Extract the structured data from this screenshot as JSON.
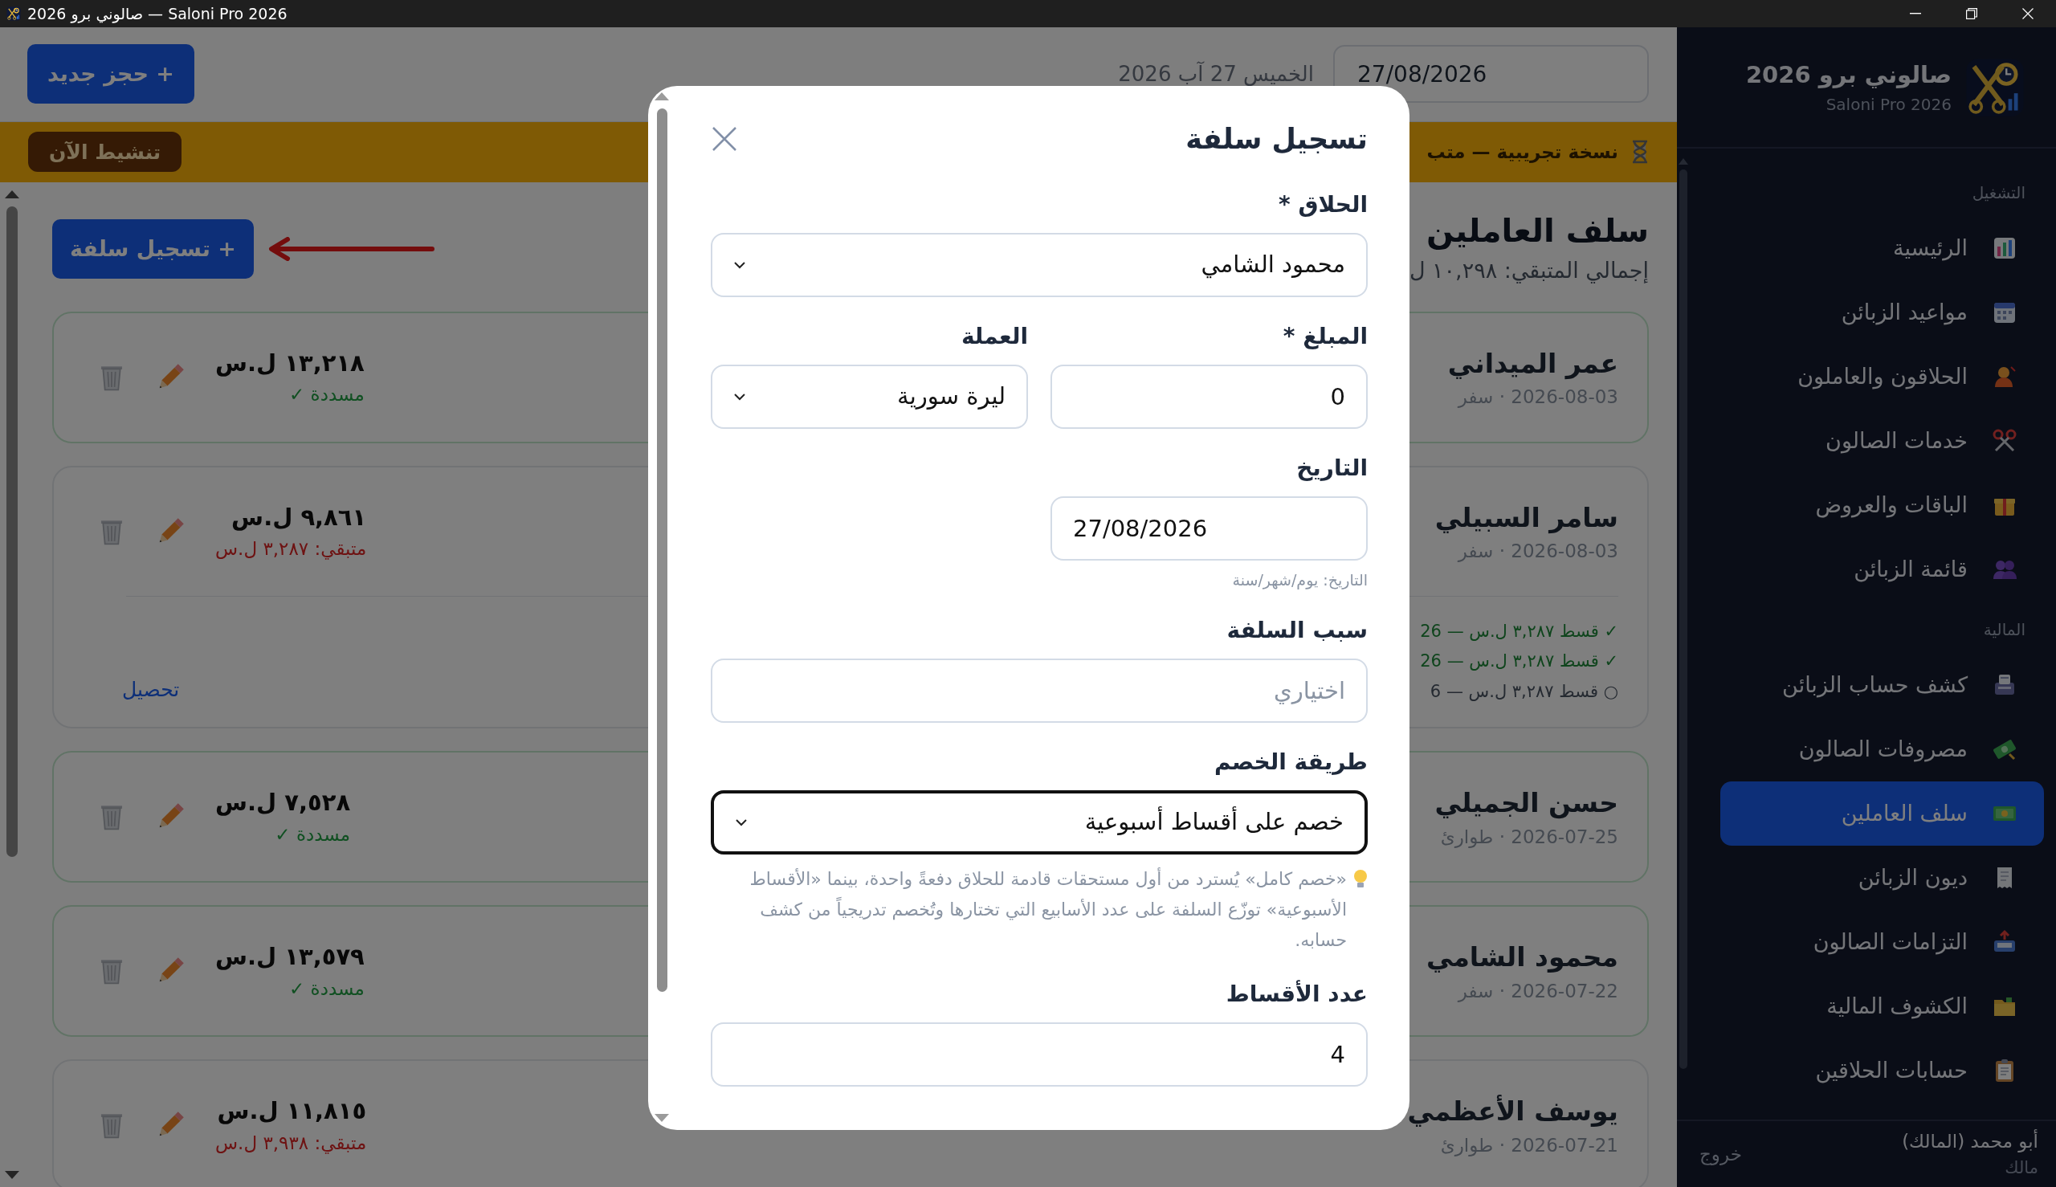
{
  "window": {
    "title": "صالوني برو 2026 — Saloni Pro 2026"
  },
  "header": {
    "new_booking_button": "+ حجز جديد",
    "date_text": "الخميس 27 آب 2026",
    "date_value": "27/08/2026"
  },
  "trial_banner": {
    "text": "نسخة تجريبية — متب",
    "activate_button": "تنشيط الآن"
  },
  "page": {
    "title": "سلف العاملين",
    "subtitle": "إجمالي المتبقي: ١٠,٢٩٨ ل",
    "add_button": "+ تسجيل سلفة"
  },
  "advances": [
    {
      "name": "عمر الميداني",
      "meta": "2026-08-03 · سفر",
      "amount": "١٣,٢١٨ ل.س",
      "kind": "paid",
      "status": "مسددة ✓"
    },
    {
      "name": "سامر السبيلي",
      "meta": "2026-08-03 · سفر",
      "amount": "٩,٨٦١ ل.س",
      "kind": "remaining",
      "status": "متبقي: ٣,٢٨٧ ل.س",
      "installments": [
        {
          "text": "✓ قسط ٣,٢٨٧ ل.س — 26",
          "paid": true
        },
        {
          "text": "✓ قسط ٣,٢٨٧ ل.س — 26",
          "paid": true
        },
        {
          "text": "○ قسط ٣,٢٨٧ ل.س — 6",
          "paid": false
        }
      ],
      "collect_link": "تحصيل"
    },
    {
      "name": "حسن الجميلي",
      "meta": "2026-07-25 · طوارئ",
      "amount": "٧,٥٢٨ ل.س",
      "kind": "paid",
      "status": "مسددة ✓"
    },
    {
      "name": "محمود الشامي",
      "meta": "2026-07-22 · سفر",
      "amount": "١٣,٥٧٩ ل.س",
      "kind": "paid",
      "status": "مسددة ✓"
    },
    {
      "name": "يوسف الأعظمي",
      "meta": "2026-07-21 · طوارئ",
      "amount": "١١,٨١٥ ل.س",
      "kind": "remaining",
      "status": "متبقي: ٣,٩٣٨ ل.س"
    }
  ],
  "modal": {
    "title": "تسجيل سلفة",
    "rows": [
      [
        {
          "kind": "select",
          "label": "الحلاق *",
          "value": "محمود الشامي",
          "focused": false
        }
      ],
      [
        {
          "kind": "number",
          "label": "المبلغ *",
          "value": "0",
          "focused": false
        },
        {
          "kind": "select",
          "label": "العملة",
          "value": "ليرة سورية",
          "focused": false
        }
      ],
      [
        {
          "kind": "date",
          "label": "التاريخ",
          "value": "27/08/2026",
          "focused": false,
          "hint": {
            "kind": "note",
            "text": "التاريخ: يوم/شهر/سنة"
          }
        }
      ],
      [
        {
          "kind": "text",
          "label": "سبب السلفة",
          "placeholder": "اختياري",
          "focused": false
        }
      ],
      [
        {
          "kind": "select",
          "label": "طريقة الخصم",
          "value": "خصم على أقساط أسبوعية",
          "focused": true,
          "hint": {
            "kind": "tip",
            "text": "«خصم كامل» يُسترد من أول مستحقات قادمة للحلاق دفعةً واحدة، بينما «الأقساط الأسبوعية» توزّع السلفة على عدد الأسابيع التي تختارها وتُخصم تدريجياً من كشف حسابه."
          }
        }
      ],
      [
        {
          "kind": "number",
          "label": "عدد الأقساط",
          "value": "4",
          "focused": false
        }
      ]
    ]
  },
  "sidebar": {
    "brand": {
      "title": "صالوني برو 2026",
      "subtitle": "Saloni Pro 2026"
    },
    "sections": [
      {
        "title": "التشغيل",
        "items": [
          {
            "label": "الرئيسية",
            "selected": false
          },
          {
            "label": "مواعيد الزبائن",
            "selected": false
          },
          {
            "label": "الحلاقون والعاملون",
            "selected": false
          },
          {
            "label": "خدمات الصالون",
            "selected": false
          },
          {
            "label": "الباقات والعروض",
            "selected": false
          },
          {
            "label": "قائمة الزبائن",
            "selected": false
          }
        ]
      },
      {
        "title": "المالية",
        "items": [
          {
            "label": "كشف حساب الزبائن",
            "selected": false
          },
          {
            "label": "مصروفات الصالون",
            "selected": false
          },
          {
            "label": "سلف العاملين",
            "selected": true
          },
          {
            "label": "ديون الزبائن",
            "selected": false
          },
          {
            "label": "التزامات الصالون",
            "selected": false
          },
          {
            "label": "الكشوف المالية",
            "selected": false
          },
          {
            "label": "حسابات الحلاقين",
            "selected": false
          }
        ]
      }
    ],
    "user": {
      "name": "أبو محمد (المالك)",
      "role": "مالك"
    },
    "logout": "خروج"
  }
}
